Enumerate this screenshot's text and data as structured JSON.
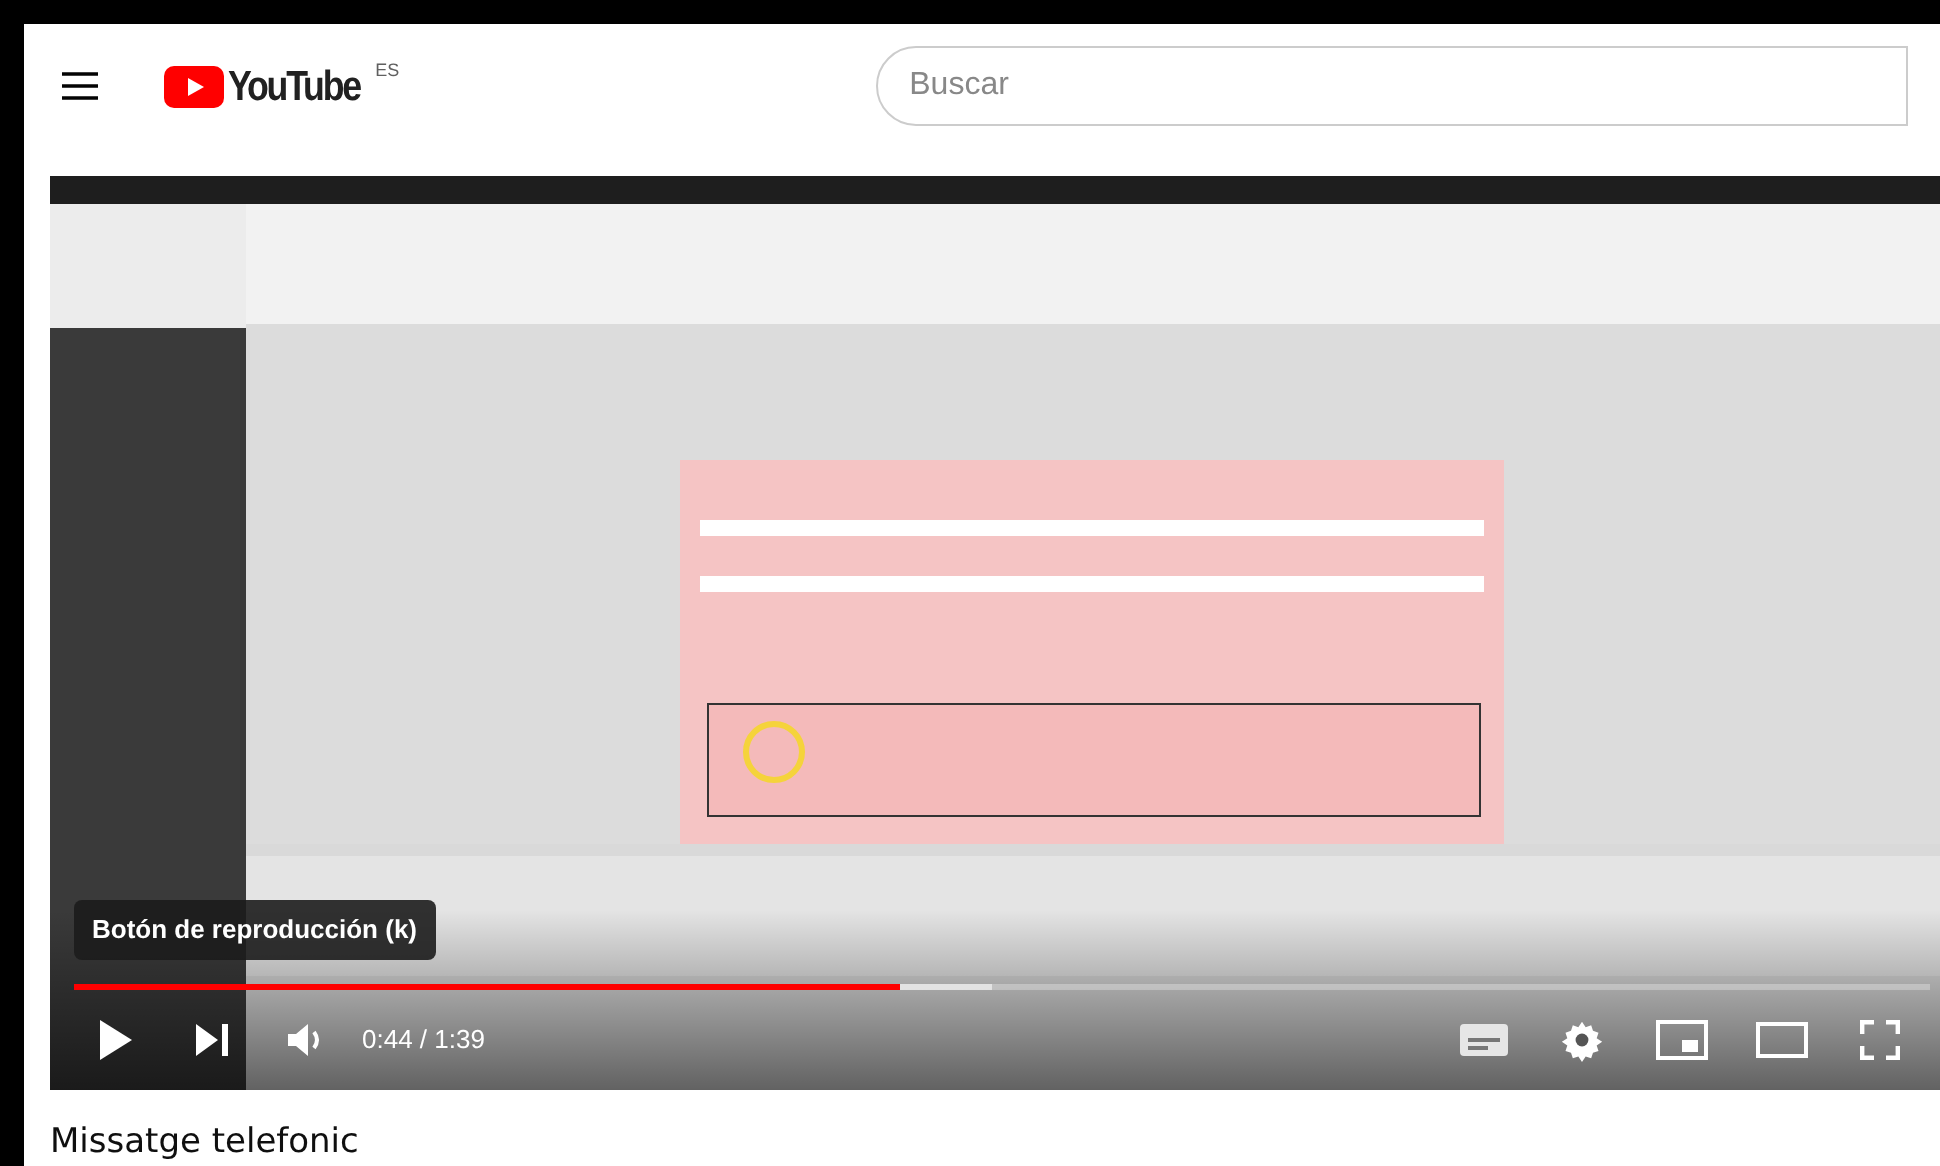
{
  "header": {
    "logo_text": "YouTube",
    "country_code": "ES",
    "search": {
      "placeholder": "Buscar"
    }
  },
  "player": {
    "tooltip": "Botón de reproducción (k)",
    "progress": {
      "level": 0.445,
      "buffered": {
        "level": 0.495
      }
    },
    "time": "0:44 / 1:39"
  },
  "video": {
    "title": "Missatge telefonic"
  }
}
